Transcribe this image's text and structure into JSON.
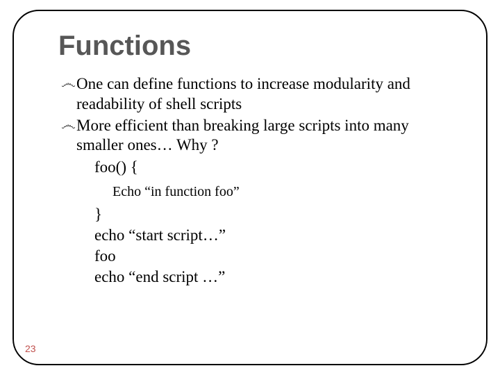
{
  "title": "Functions",
  "bullets": [
    "One can define functions to increase modularity and readability of shell scripts",
    "More efficient than breaking large scripts into many smaller ones… Why ?"
  ],
  "code": {
    "pre": "foo() {",
    "inner": "Echo “in function foo”",
    "post": [
      "}",
      "echo “start script…”",
      "foo",
      "echo “end script …”"
    ]
  },
  "page_number": "23",
  "bullet_glyph": "෴"
}
